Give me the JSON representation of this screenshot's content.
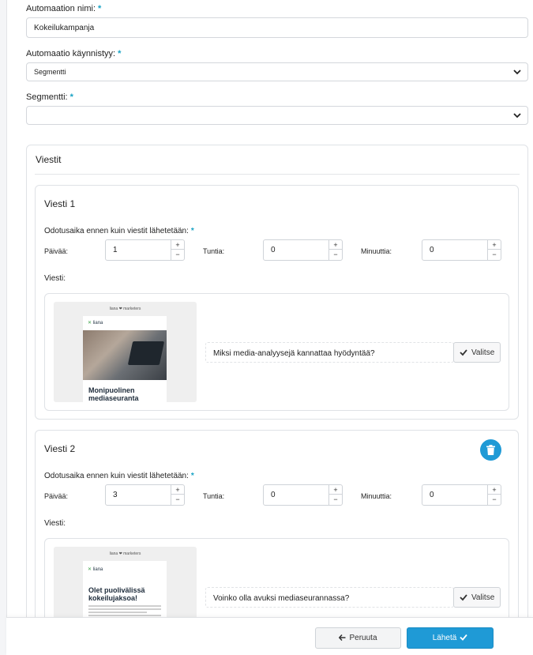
{
  "form": {
    "name_label": "Automaation nimi:",
    "name_value": "Kokeilukampanja",
    "trigger_label": "Automaatio käynnistyy:",
    "trigger_value": "Segmentti",
    "segment_label": "Segmentti:",
    "segment_value": "",
    "required_mark": "*"
  },
  "messages_section": {
    "title": "Viestit",
    "messages": [
      {
        "title": "Viesti 1",
        "wait_label": "Odotusaika ennen kuin viestit lähetetään:",
        "days_label": "Päivää:",
        "days_value": "1",
        "hours_label": "Tuntia:",
        "hours_value": "0",
        "minutes_label": "Minuuttia:",
        "minutes_value": "0",
        "message_label": "Viesti:",
        "thumb_brand": "liana ❤ marketers",
        "thumb_logo": "liana",
        "thumb_headline": "Monipuolinen mediaseuranta",
        "subject": "Miksi media-analyysejä kannattaa hyödyntää?",
        "select_label": "Valitse"
      },
      {
        "title": "Viesti 2",
        "wait_label": "Odotusaika ennen kuin viestit lähetetään:",
        "days_label": "Päivää:",
        "days_value": "3",
        "hours_label": "Tuntia:",
        "hours_value": "0",
        "minutes_label": "Minuuttia:",
        "minutes_value": "0",
        "message_label": "Viesti:",
        "thumb_brand": "liana ❤ marketers",
        "thumb_logo": "liana",
        "thumb_headline": "Olet puolivälissä kokeilujaksoa!",
        "subject": "Voinko olla avuksi mediaseurannassa?",
        "select_label": "Valitse"
      }
    ]
  },
  "stepper": {
    "plus": "+",
    "minus": "−"
  },
  "footer": {
    "cancel_label": "Peruuta",
    "send_label": "Lähetä"
  },
  "colors": {
    "accent": "#1f9ad6",
    "required": "#17a2c4"
  },
  "icons": {
    "select": "check-icon",
    "trash": "trash-icon",
    "cancel": "arrow-left-icon",
    "send": "check-icon",
    "dropdown": "chevron-down-icon"
  }
}
